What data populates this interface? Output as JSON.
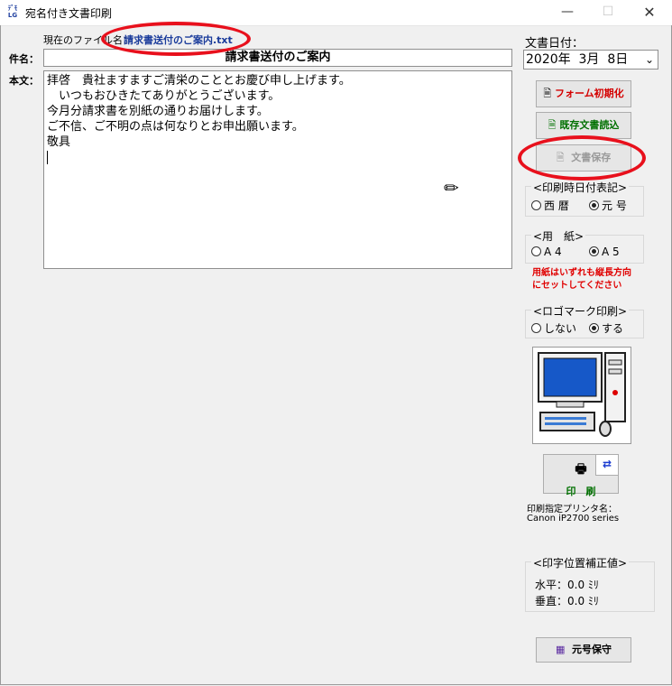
{
  "window": {
    "title": "宛名付き文書印刷",
    "icon_text": "ﾃﾞﾓ LG"
  },
  "file": {
    "label": "現在のファイル名：",
    "name": "請求書送付のご案内.txt"
  },
  "subject": {
    "label": "件名：",
    "value": "請求書送付のご案内"
  },
  "body": {
    "label": "本文：",
    "text": "拝啓　貴社ますますご清栄のこととお慶び申し上げます。\n　いつもおひきたてありがとうございます。\n今月分請求書を別紙の通りお届けします。\nご不信、ご不明の点は何なりとお申出願います。\n敬具"
  },
  "date": {
    "label": "文書日付：",
    "value": "2020年  3月  8日"
  },
  "buttons": {
    "init_form": "フォーム初期化",
    "load_doc": "既存文書読込",
    "save_doc": "文書保存",
    "print": "印　刷",
    "era_save": "元号保守"
  },
  "date_format": {
    "title": "<印刷時日付表記>",
    "options": [
      "西 暦",
      "元 号"
    ],
    "selected": 1
  },
  "paper": {
    "title": "<用　紙>",
    "options": [
      "A 4",
      "A 5"
    ],
    "selected": 1,
    "note_line1": "用紙はいずれも縦長方向",
    "note_line2": "にセットしてください"
  },
  "logo": {
    "title": "<ロゴマーク印刷>",
    "options": [
      "しない",
      "する"
    ],
    "selected": 1
  },
  "printer": {
    "label": "印刷指定プリンタ名：",
    "name": "Canon iP2700 series"
  },
  "offset": {
    "title": "<印字位置補正値>",
    "horizontal": "水平：0.0 ﾐﾘ",
    "vertical": "垂直：0.0 ﾐﾘ"
  },
  "colors": {
    "annotation_ring": "#e8101c",
    "file_name": "#1a3b9b",
    "init_text": "#d40000",
    "load_text": "#007000",
    "print_text": "#007000"
  }
}
